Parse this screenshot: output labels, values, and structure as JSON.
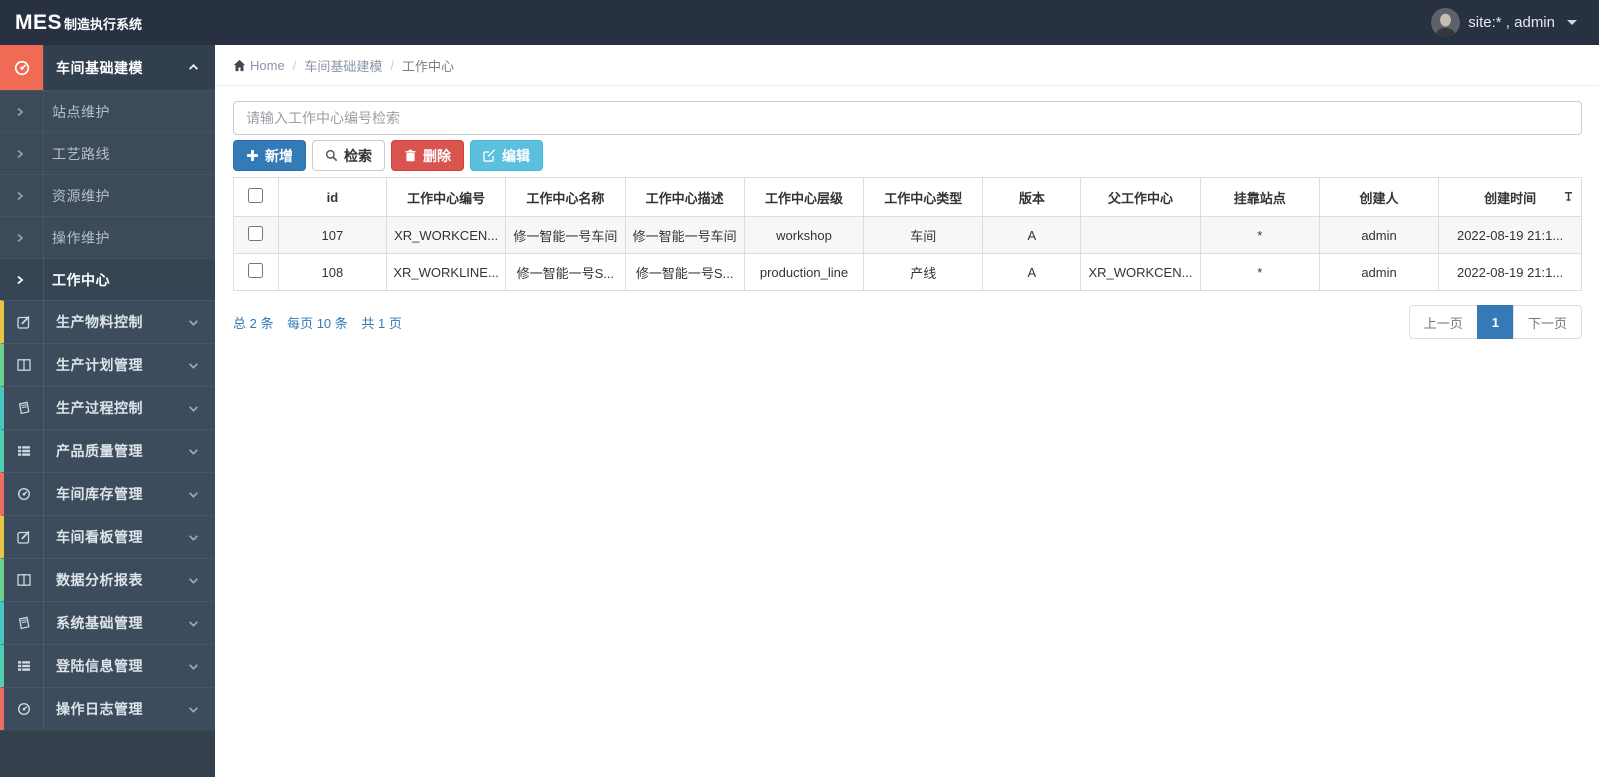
{
  "theme": {
    "navbar_bg": "#273142",
    "sidebar_bg": "#3d4c5c",
    "active_icon_bg": "#ef6b55",
    "primary_blue": "#337ab7",
    "info_blue": "#5bc0de",
    "danger_red": "#d9534f",
    "accent_cycle": [
      "#eac545",
      "#6ecf8e",
      "#49c6c0",
      "#4ecfb0",
      "#eb6e61"
    ]
  },
  "navbar": {
    "logo_bold": "MES",
    "logo_rest": "制造执行系统",
    "user_label": "site:* , admin"
  },
  "breadcrumb": {
    "home": "Home",
    "sep1": "/",
    "section": "车间基础建模",
    "sep2": "/",
    "current": "工作中心"
  },
  "sidebar": {
    "active_parent": {
      "label": "车间基础建模",
      "icon": "tachometer-icon"
    },
    "submenu": [
      {
        "label": "站点维护"
      },
      {
        "label": "工艺路线"
      },
      {
        "label": "资源维护"
      },
      {
        "label": "操作维护"
      },
      {
        "label": "工作中心"
      }
    ],
    "parents": [
      {
        "label": "生产物料控制",
        "icon": "pencil-square-icon"
      },
      {
        "label": "生产计划管理",
        "icon": "columns-icon"
      },
      {
        "label": "生产过程控制",
        "icon": "book-icon"
      },
      {
        "label": "产品质量管理",
        "icon": "th-list-icon"
      },
      {
        "label": "车间库存管理",
        "icon": "tachometer-icon"
      },
      {
        "label": "车间看板管理",
        "icon": "pencil-square-icon"
      },
      {
        "label": "数据分析报表",
        "icon": "columns-icon"
      },
      {
        "label": "系统基础管理",
        "icon": "book-icon"
      },
      {
        "label": "登陆信息管理",
        "icon": "th-list-icon"
      },
      {
        "label": "操作日志管理",
        "icon": "tachometer-icon"
      }
    ]
  },
  "toolbar": {
    "search_placeholder": "请输入工作中心编号检索",
    "add_label": "新增",
    "search_label": "检索",
    "delete_label": "删除",
    "edit_label": "编辑"
  },
  "table": {
    "headers": [
      "id",
      "工作中心编号",
      "工作中心名称",
      "工作中心描述",
      "工作中心层级",
      "工作中心类型",
      "版本",
      "父工作中心",
      "挂靠站点",
      "创建人",
      "创建时间"
    ],
    "rows": [
      {
        "cells": [
          "107",
          "XR_WORKCEN...",
          "修一智能一号车间",
          "修一智能一号车间",
          "workshop",
          "车间",
          "A",
          "",
          "*",
          "admin",
          "2022-08-19 21:1..."
        ]
      },
      {
        "cells": [
          "108",
          "XR_WORKLINE...",
          "修一智能一号S...",
          "修一智能一号S...",
          "production_line",
          "产线",
          "A",
          "XR_WORKCEN...",
          "*",
          "admin",
          "2022-08-19 21:1..."
        ]
      }
    ]
  },
  "pagination": {
    "total": "总 2 条",
    "per_page": "每页 10 条",
    "pages": "共 1 页",
    "prev_label": "上一页",
    "page_label": "1",
    "next_label": "下一页"
  }
}
